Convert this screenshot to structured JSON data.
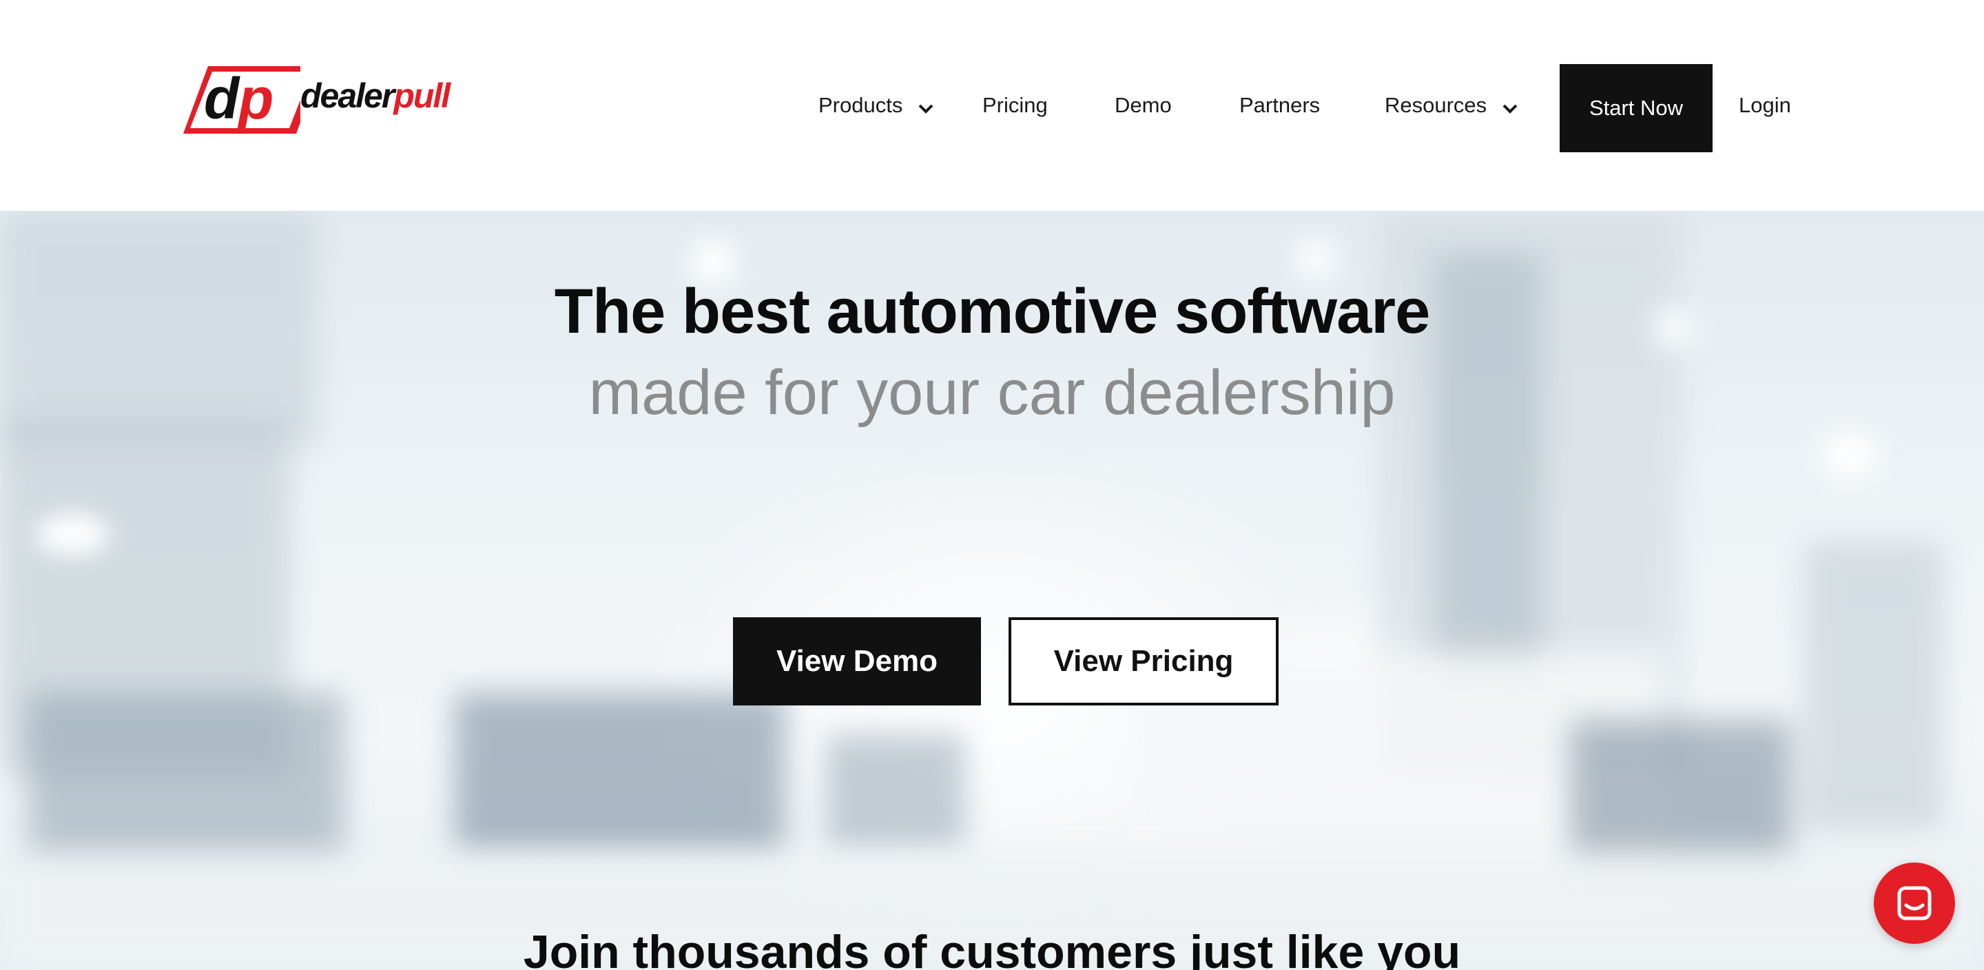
{
  "header": {
    "logo": {
      "mark": "dp",
      "name_part1": "dealer",
      "name_part2": "pull"
    },
    "nav": [
      {
        "label": "Products",
        "has_dropdown": true
      },
      {
        "label": "Pricing",
        "has_dropdown": false
      },
      {
        "label": "Demo",
        "has_dropdown": false
      },
      {
        "label": "Partners",
        "has_dropdown": false
      },
      {
        "label": "Resources",
        "has_dropdown": true
      }
    ],
    "start_button": "Start Now",
    "login": "Login"
  },
  "hero": {
    "title": "The best automotive software",
    "subtitle": "made for your car dealership",
    "primary_button": "View Demo",
    "secondary_button": "View Pricing"
  },
  "section": {
    "heading": "Join thousands of customers just like you"
  },
  "colors": {
    "brand_red": "#e41e26",
    "dark": "#111111",
    "subtitle_gray": "#8c8c8c"
  },
  "icons": {
    "chat": "chat-bubble-icon",
    "dropdown": "chevron-down-icon"
  }
}
